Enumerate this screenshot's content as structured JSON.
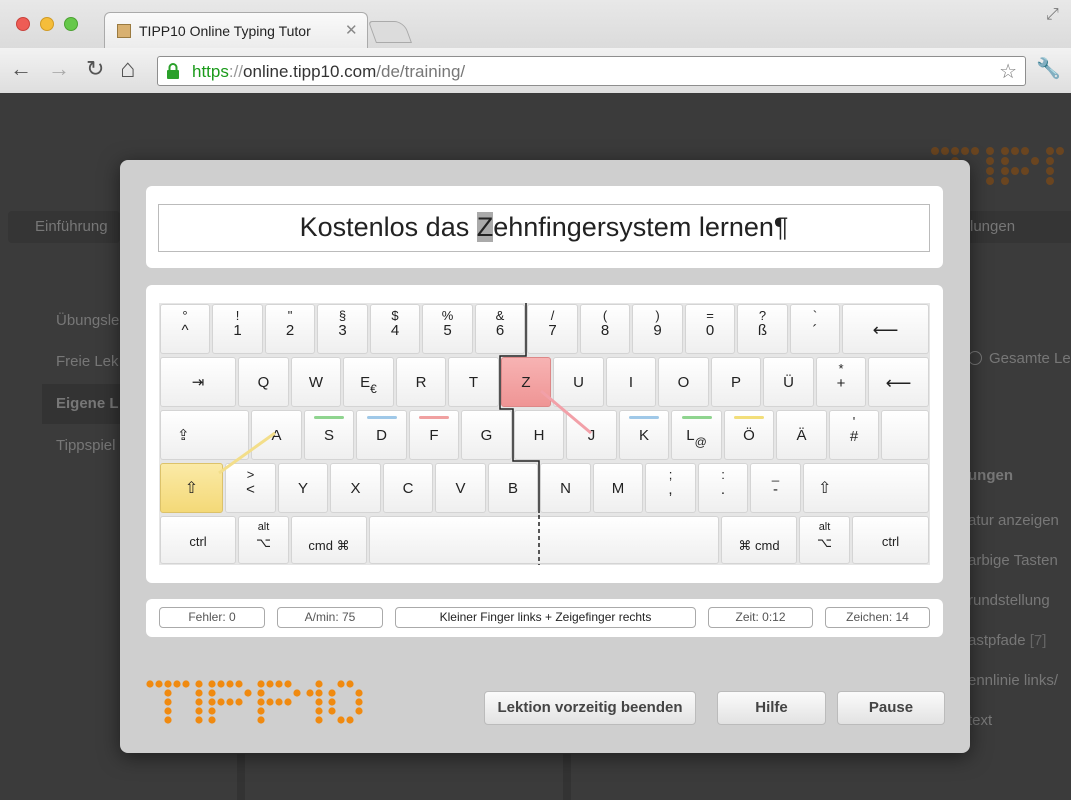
{
  "browser": {
    "tab_title": "TIPP10 Online Typing Tutor",
    "tab_close": "✕",
    "url_scheme": "https",
    "url_sep": "://",
    "url_host": "online.tipp10.com",
    "url_path": "/de/training/",
    "back": "←",
    "forward": "→",
    "reload": "↻",
    "home": "⌂",
    "star": "☆",
    "wrench": "🔧",
    "resize": "⤢"
  },
  "background": {
    "nav_first": "Einführung",
    "nav_last": "lungen",
    "menu": [
      "Übungsle",
      "Freie Lek",
      "Eigene L",
      "Tippspiel"
    ],
    "right_radio": "Gesamte Le",
    "right_heading": "ungen",
    "right_items": [
      "atur anzeigen",
      "arbige Tasten",
      "rundstellung",
      "astpfade",
      "ennlinie links/",
      "text"
    ],
    "right_item_badge": "[7]"
  },
  "lesson": {
    "before": "Kostenlos das ",
    "current": "Z",
    "after": "ehnfingersystem lernen¶"
  },
  "keyboard": {
    "row1": [
      {
        "t": "°",
        "b": "^"
      },
      {
        "t": "!",
        "b": "1"
      },
      {
        "t": "\"",
        "b": "2"
      },
      {
        "t": "§",
        "b": "3"
      },
      {
        "t": "$",
        "b": "4"
      },
      {
        "t": "%",
        "b": "5"
      },
      {
        "t": "&",
        "b": "6"
      },
      {
        "t": "/",
        "b": "7"
      },
      {
        "t": "(",
        "b": "8"
      },
      {
        "t": ")",
        "b": "9"
      },
      {
        "t": "=",
        "b": "0"
      },
      {
        "t": "?",
        "b": "ß"
      },
      {
        "t": "`",
        "b": "´"
      },
      {
        "t": "",
        "b": "⟵"
      }
    ],
    "row2": [
      "⇥",
      "Q",
      "W",
      "E",
      "R",
      "T",
      "Z",
      "U",
      "I",
      "O",
      "P",
      "Ü",
      "+",
      "⟵"
    ],
    "row2_e_sub": "€",
    "row2_plus_top": "*",
    "row3": [
      "⇪",
      "A",
      "S",
      "D",
      "F",
      "G",
      "H",
      "J",
      "K",
      "L",
      "Ö",
      "Ä",
      "#"
    ],
    "row3_l_sub": "@",
    "row3_hash_top": "'",
    "row4": [
      "⇧",
      "<",
      "Y",
      "X",
      "C",
      "V",
      "B",
      "N",
      "M",
      ";",
      ":",
      "_",
      "⇧"
    ],
    "row4_lt_top": ">",
    "row4_m_bottom": [
      ",",
      ".",
      "-"
    ],
    "row5": [
      {
        "t": "",
        "b": "ctrl"
      },
      {
        "t": "alt",
        "b": "⌥"
      },
      {
        "t": "",
        "b": "cmd ⌘"
      },
      {
        "t": "",
        "b": ""
      },
      {
        "t": "",
        "b": "⌘ cmd"
      },
      {
        "t": "alt",
        "b": "⌥"
      },
      {
        "t": "",
        "b": "ctrl"
      }
    ],
    "colors": {
      "red": "#ef9595",
      "yellow": "#f4d978",
      "green": "#8fd48f",
      "blue": "#9fc8e8",
      "pink": "#f0a0a0",
      "gold": "#f2de7a"
    }
  },
  "status": {
    "errors": "Fehler: 0",
    "speed": "A/min: 75",
    "fingers": "Kleiner Finger links + Zeigefinger rechts",
    "time": "Zeit: 0:12",
    "chars": "Zeichen: 14"
  },
  "buttons": {
    "end_lesson": "Lektion vorzeitig beenden",
    "help": "Hilfe",
    "pause": "Pause"
  },
  "logo_color": "#f08a10"
}
